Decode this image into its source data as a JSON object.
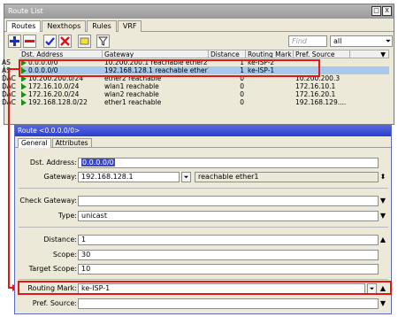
{
  "route_list": {
    "title": "Route List",
    "close_glyph": "X",
    "restore_glyph": "□",
    "tabs": [
      "Routes",
      "Nexthops",
      "Rules",
      "VRF"
    ],
    "find_placeholder": "Find",
    "filter_value": "all",
    "columns": [
      "Dst. Address",
      "Gateway",
      "Distance",
      "Routing Mark",
      "Pref. Source",
      "▼"
    ],
    "rows": [
      {
        "flags": "AS",
        "dst": "0.0.0.0/0",
        "gw": "10.200.200.1 reachable ether2",
        "dist": "1",
        "mark": "ke-ISP-2",
        "pref": "",
        "selected": false
      },
      {
        "flags": "AS",
        "dst": "0.0.0.0/0",
        "gw": "192.168.128.1 reachable ether1",
        "dist": "1",
        "mark": "ke-ISP-1",
        "pref": "",
        "selected": true
      },
      {
        "flags": "DAC",
        "dst": "10.200.200.0/24",
        "gw": "ether2 reachable",
        "dist": "0",
        "mark": "",
        "pref": "10.200.200.3",
        "selected": false
      },
      {
        "flags": "DAC",
        "dst": "172.16.10.0/24",
        "gw": "wlan1 reachable",
        "dist": "0",
        "mark": "",
        "pref": "172.16.10.1",
        "selected": false
      },
      {
        "flags": "DAC",
        "dst": "172.16.20.0/24",
        "gw": "wlan2 reachable",
        "dist": "0",
        "mark": "",
        "pref": "172.16.20.1",
        "selected": false
      },
      {
        "flags": "DAC",
        "dst": "192.168.128.0/22",
        "gw": "ether1 reachable",
        "dist": "0",
        "mark": "",
        "pref": "192.168.129....",
        "selected": false
      }
    ]
  },
  "route_dialog": {
    "title": "Route <0.0.0.0/0>",
    "tabs": [
      "General",
      "Attributes"
    ],
    "fields": {
      "dst_address": {
        "label": "Dst. Address:",
        "value": "0.0.0.0/0"
      },
      "gateway": {
        "label": "Gateway:",
        "value": "192.168.128.1",
        "status": "reachable ether1"
      },
      "check_gateway": {
        "label": "Check Gateway:",
        "value": ""
      },
      "type": {
        "label": "Type:",
        "value": "unicast"
      },
      "distance": {
        "label": "Distance:",
        "value": "1"
      },
      "scope": {
        "label": "Scope:",
        "value": "30"
      },
      "target_scope": {
        "label": "Target Scope:",
        "value": "10"
      },
      "routing_mark": {
        "label": "Routing Mark:",
        "value": "ke-ISP-1"
      },
      "pref_source": {
        "label": "Pref. Source:",
        "value": ""
      }
    }
  },
  "colors": {
    "highlight": "#e01818",
    "selection": "#a8c8ee",
    "dialog_title": "#2a3ed0",
    "reachable_flag": "#1a8a1a"
  }
}
